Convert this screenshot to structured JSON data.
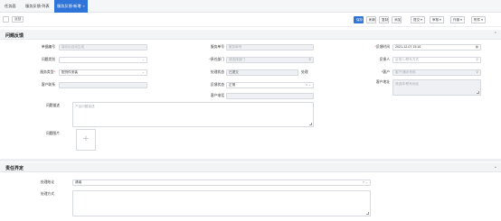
{
  "tabs": [
    {
      "label": "任务面",
      "active": false
    },
    {
      "label": "服务反馈-列表",
      "active": false
    },
    {
      "label": "服务反馈-新增",
      "active": true
    }
  ],
  "toolbar": {
    "back_label": "返回",
    "buttons": [
      "保存",
      "刷新",
      "复制",
      "添加",
      "提交",
      "审核",
      "作废",
      "附件"
    ]
  },
  "section1": {
    "title": "问题反馈"
  },
  "section2": {
    "title": "责任界定"
  },
  "fields": {
    "bill_no": {
      "label": "单据编号",
      "placeholder": "保存后自动生成"
    },
    "service_no": {
      "label": "服务单号",
      "placeholder": "服务单号"
    },
    "feedback_time": {
      "label": "反馈时间",
      "value": "2021-12-07 15:16"
    },
    "problem_type": {
      "label": "问题类别",
      "value": ""
    },
    "resp_dept": {
      "label": "*责任部门",
      "placeholder": "请选择部门"
    },
    "feedbacker": {
      "label": "反馈人",
      "placeholder": "反馈人/联系方式"
    },
    "service_type": {
      "label": "服务类型",
      "value": "配货件安装"
    },
    "handle_status": {
      "label": "处理状态",
      "value": "已提交",
      "suffix": "处理"
    },
    "customer": {
      "label": "*客户",
      "placeholder": "客户/通讯号码"
    },
    "customer_contact": {
      "label": "客户联系",
      "value": ""
    },
    "feedback_status": {
      "label": "反馈状态",
      "value": "正常"
    },
    "customer_addr": {
      "label": "客户地址",
      "placeholder": "请选择/联系地址"
    },
    "customer_phone": {
      "label": "客户电话",
      "value": ""
    },
    "problem_desc": {
      "label": "问题描述",
      "placeholder": "产品问题描述"
    },
    "problem_images": {
      "label": "问题图片"
    },
    "handle_conclusion": {
      "label": "处理结论",
      "value": "请填"
    },
    "handle_method": {
      "label": "处理方式",
      "value": ""
    }
  },
  "icons": {
    "calendar": "calendar-icon",
    "search": "search-icon",
    "chevron": "chevron-down-icon",
    "clear": "clear-icon"
  },
  "colors": {
    "primary": "#2f74d8"
  }
}
